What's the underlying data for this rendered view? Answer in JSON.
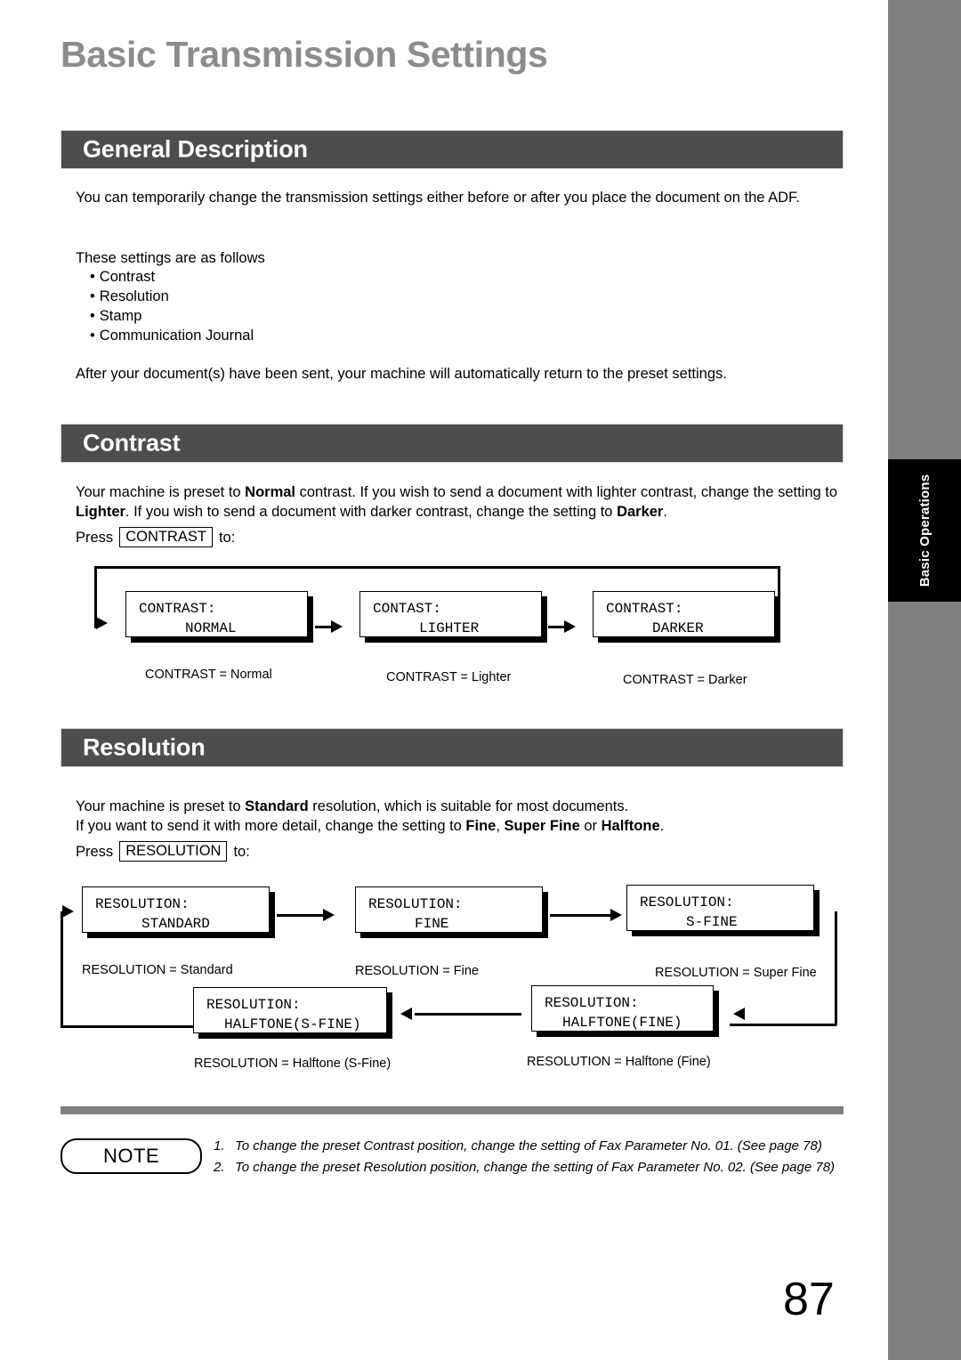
{
  "page": {
    "title": "Basic Transmission Settings",
    "number": "87",
    "side_tab": "Basic Operations",
    "colors": {
      "title_gray": "#8c8c8c",
      "section_bar": "#4d4d4d",
      "edge_strip": "#808080",
      "tab_black": "#000000"
    }
  },
  "sections": {
    "general_description": {
      "heading": "General Description",
      "paragraph_1": "You can temporarily change the transmission settings either before or after you place the document on the ADF.",
      "paragraph_2": "These settings are as follows",
      "bullets": [
        "Contrast",
        "Resolution",
        "Stamp",
        "Communication Journal"
      ],
      "paragraph_3": "After your document(s) have been sent, your machine will automatically return to the preset settings."
    },
    "contrast": {
      "heading": "Contrast",
      "intro_a": "Your machine is preset to ",
      "intro_b": "Normal",
      "intro_c": " contrast.  If you wish to send a document with lighter contrast, change the setting to ",
      "intro_d": "Lighter",
      "intro_e": ".  If you wish to send a document with darker contrast, change the setting to ",
      "intro_f": "Darker",
      "intro_g": ".",
      "press_prefix": "Press",
      "key_label": "CONTRAST",
      "press_suffix": "to:",
      "steps": [
        {
          "line1": "CONTRAST:",
          "line2": "NORMAL",
          "caption": "CONTRAST = Normal"
        },
        {
          "line1": "CONTAST:",
          "line2": "LIGHTER",
          "caption": "CONTRAST = Lighter"
        },
        {
          "line1": "CONTRAST:",
          "line2": "DARKER",
          "caption": "CONTRAST = Darker"
        }
      ]
    },
    "resolution": {
      "heading": "Resolution",
      "intro_a": "Your machine is preset to ",
      "intro_b": "Standard",
      "intro_c": " resolution, which is suitable for most documents.",
      "intro_d": "If you want to send it with more detail, change the setting to ",
      "intro_e": "Fine",
      "intro_f": ", ",
      "intro_g": "Super Fine",
      "intro_h": " or ",
      "intro_i": "Halftone",
      "intro_j": ".",
      "press_prefix": "Press",
      "key_label": "RESOLUTION",
      "press_suffix": "to:",
      "steps": [
        {
          "line1": "RESOLUTION:",
          "line2": "STANDARD",
          "caption": "RESOLUTION = Standard"
        },
        {
          "line1": "RESOLUTION:",
          "line2": "FINE",
          "caption": "RESOLUTION = Fine"
        },
        {
          "line1": "RESOLUTION:",
          "line2": "S-FINE",
          "caption": "RESOLUTION = Super Fine"
        },
        {
          "line1": "RESOLUTION:",
          "line2": "HALFTONE(FINE)",
          "caption": "RESOLUTION = Halftone (Fine)"
        },
        {
          "line1": "RESOLUTION:",
          "line2": "HALFTONE(S-FINE)",
          "caption": "RESOLUTION = Halftone (S-Fine)"
        }
      ]
    }
  },
  "note": {
    "badge": "NOTE",
    "items": [
      {
        "num": "1.",
        "text": "To change the preset Contrast position, change the setting of Fax Parameter No. 01. (See page 78)"
      },
      {
        "num": "2.",
        "text": "To change the preset Resolution position, change the setting of Fax Parameter No. 02.  (See page 78)"
      }
    ]
  }
}
